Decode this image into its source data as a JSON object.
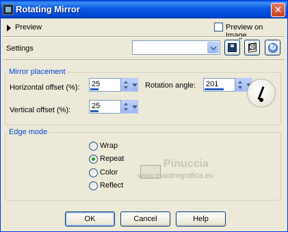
{
  "window": {
    "title": "Rotating Mirror",
    "close_icon": "close-icon"
  },
  "preview": {
    "label": "Preview",
    "checkbox_label": "Preview on Image",
    "checkbox_checked": false
  },
  "settings": {
    "label": "Settings",
    "combo_value": ""
  },
  "mirror_placement": {
    "legend": "Mirror placement",
    "horizontal_label": "Horizontal offset (%):",
    "horizontal_value": "25",
    "vertical_label": "Vertical offset (%):",
    "vertical_value": "25",
    "rotation_label": "Rotation angle:",
    "rotation_value": "201"
  },
  "edge_mode": {
    "legend": "Edge mode",
    "options": [
      {
        "label": "Wrap",
        "checked": false
      },
      {
        "label": "Repeat",
        "checked": true
      },
      {
        "label": "Color",
        "checked": false
      },
      {
        "label": "Reflect",
        "checked": false
      }
    ]
  },
  "watermark": {
    "name": "Pinuccia",
    "url": "www.maidiregrafica.eu"
  },
  "buttons": {
    "ok": "OK",
    "cancel": "Cancel",
    "help": "Help"
  },
  "colors": {
    "title_bar": "#0a5fe0",
    "group_legend": "#0046d5",
    "dialog_bg": "#ece9d8",
    "radio_checked": "#21a121"
  }
}
